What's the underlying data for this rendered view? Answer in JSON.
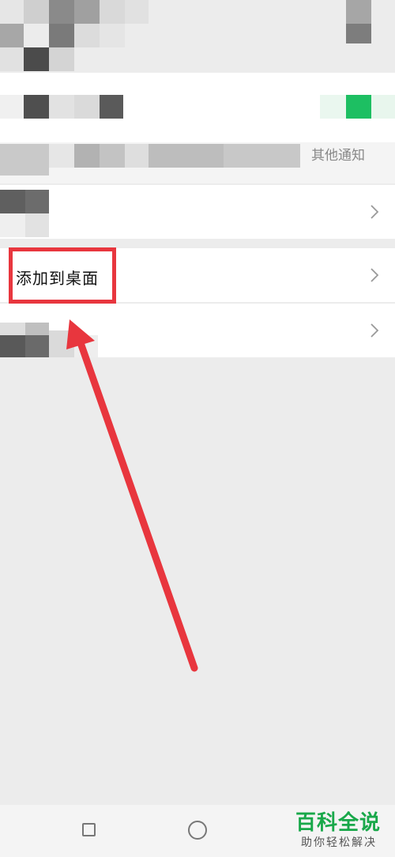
{
  "rows": {
    "notification_text": "其他通知",
    "add_to_desktop": "添加到桌面"
  },
  "watermark": {
    "brand": "百科全说",
    "tagline": "助你轻松解决"
  },
  "colors": {
    "background": "#ececec",
    "toggle_on": "#1dbf62",
    "annotation_red": "#e8363e",
    "watermark_green": "#19a84a"
  },
  "icons": [
    "chevron-right-icon",
    "nav-recent-icon",
    "nav-home-icon"
  ]
}
